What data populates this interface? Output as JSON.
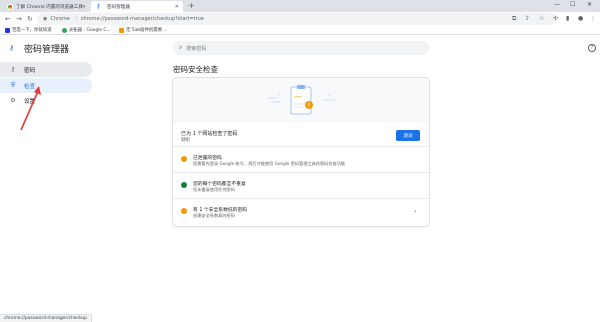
{
  "browser": {
    "tabs": [
      {
        "label": "了解 Chrome 内置的浏览器工具",
        "active": false
      },
      {
        "label": "密码管理器",
        "active": true
      }
    ],
    "new_tab_label": "+",
    "address": {
      "origin": "Chrome",
      "url": "chrome://password-manager/checkup?start=true"
    },
    "bookmarks": [
      {
        "label": "百度一下，你就知道",
        "color": "#2932e1"
      },
      {
        "label": "光拓器 - Google C...",
        "color": "#34a853"
      },
      {
        "label": "无 5ab插件机需要...",
        "color": "#f29900"
      }
    ],
    "status_bar": "chrome://password-manager/checkup"
  },
  "app": {
    "title": "密码管理器",
    "search_placeholder": "搜索密码"
  },
  "sidebar": {
    "items": [
      {
        "label": "密码",
        "icon": "key-icon",
        "state": "hover"
      },
      {
        "label": "检查",
        "icon": "shield-check-icon",
        "state": "selected"
      },
      {
        "label": "设置",
        "icon": "gear-icon",
        "state": "normal"
      }
    ]
  },
  "main": {
    "title": "密码安全检查",
    "status": {
      "title": "已为 1 个网站检查了密码",
      "subtitle": "刚刚",
      "button_label": "测试"
    },
    "items": [
      {
        "title": "已泄露的密码",
        "subtitle": "您需要先登录 Google 帐号，然后才能使用 Google 密码管理工具的密码检查功能",
        "status": "warning",
        "chevron": ""
      },
      {
        "title": "您的每个密码都互不重复",
        "subtitle": "您未重复使用任何密码",
        "status": "ok",
        "chevron": ""
      },
      {
        "title": "有 1 个安全系数低的密码",
        "subtitle": "创建安全系数高的密码",
        "status": "warning",
        "chevron": "›"
      }
    ]
  },
  "colors": {
    "accent": "#1a73e8",
    "warning": "#f29900",
    "success": "#188038",
    "annotation": "#e53935"
  }
}
